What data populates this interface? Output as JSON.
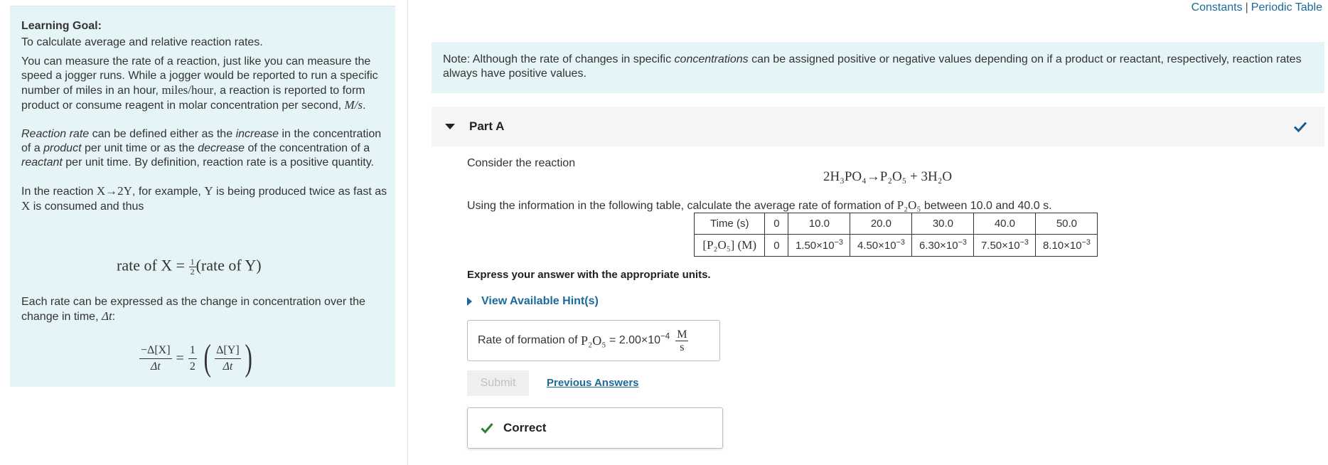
{
  "learning_goal": {
    "title": "Learning Goal:",
    "intro": "To calculate average and relative reaction rates.",
    "p1_a": "You can measure the rate of a reaction, just like you can measure the speed a jogger runs. While a jogger would be reported to run a specific number of miles in an hour,",
    "p1_unit": "miles/hour",
    "p1_b": ", a reaction is reported to form product or consume reagent in molar concentration per second,",
    "p1_unit2": "M/s",
    "p1_end": ".",
    "p2_term": "Reaction rate",
    "p2_a": "can be defined either as the",
    "p2_increase": "increase",
    "p2_b": "in the concentration of a",
    "p2_product": "product",
    "p2_c": "per unit time or as the",
    "p2_decrease": "decrease",
    "p2_d": "of the concentration of a",
    "p2_reactant": "reactant",
    "p2_e": "per unit time. By definition, reaction rate is a positive quantity.",
    "p3_a": "In the reaction",
    "p3_reaction": "X→2Y",
    "p3_b": ", for example,",
    "p3_y": "Y",
    "p3_c": "is being produced twice as fast as",
    "p3_x": "X",
    "p3_d": "is consumed and thus",
    "rate_eq_left": "rate of X =",
    "rate_eq_num": "1",
    "rate_eq_den": "2",
    "rate_eq_right": "(rate of Y)",
    "p4_a": "Each rate can be expressed as the change in concentration over the change in time,",
    "p4_delta": "Δt",
    "p4_end": ":",
    "frac1_num": "−Δ[X]",
    "frac1_den": "Δt",
    "equals": "=",
    "half_num": "1",
    "half_den": "2",
    "frac2_num": "Δ[Y]",
    "frac2_den": "Δt"
  },
  "top_links": {
    "constants": "Constants",
    "separator": "|",
    "periodic_table": "Periodic Table"
  },
  "note": {
    "a": "Note:  Although the rate of changes in specific",
    "italic": "concentrations",
    "b": "can be assigned positive or negative values depending on if a product or reactant, respectively, reaction rates always have positive values."
  },
  "part": {
    "title": "Part A",
    "consider": "Consider the reaction",
    "reaction": "2H₃PO₄→P₂O₅ + 3H₂O",
    "question_a": "Using the information in the following table, calculate the average rate of formation of",
    "question_species": "P₂O₅",
    "question_b": "between 10.0 and 40.0 s.",
    "table": {
      "row1_label": "Time (s)",
      "times": [
        "0",
        "10.0",
        "20.0",
        "30.0",
        "40.0",
        "50.0"
      ],
      "row2_label": "[P₂O₅] (M)",
      "conc_mantissa": [
        "0",
        "1.50×10",
        "4.50×10",
        "6.30×10",
        "7.50×10",
        "8.10×10"
      ],
      "conc_exp": [
        "",
        "−3",
        "−3",
        "−3",
        "−3",
        "−3"
      ]
    },
    "express": "Express your answer with the appropriate units.",
    "hints": "View Available Hint(s)",
    "answer_label": "Rate of formation of",
    "answer_species": "P₂O₅",
    "answer_eq": "=",
    "answer_value": "2.00×10",
    "answer_exp": "−4",
    "answer_unit_num": "M",
    "answer_unit_den": "s",
    "submit": "Submit",
    "previous": "Previous Answers",
    "correct": "Correct"
  },
  "colors": {
    "panel_bg": "#e5f5f7",
    "link": "#1a6a9a",
    "check": "#2e7d32"
  }
}
